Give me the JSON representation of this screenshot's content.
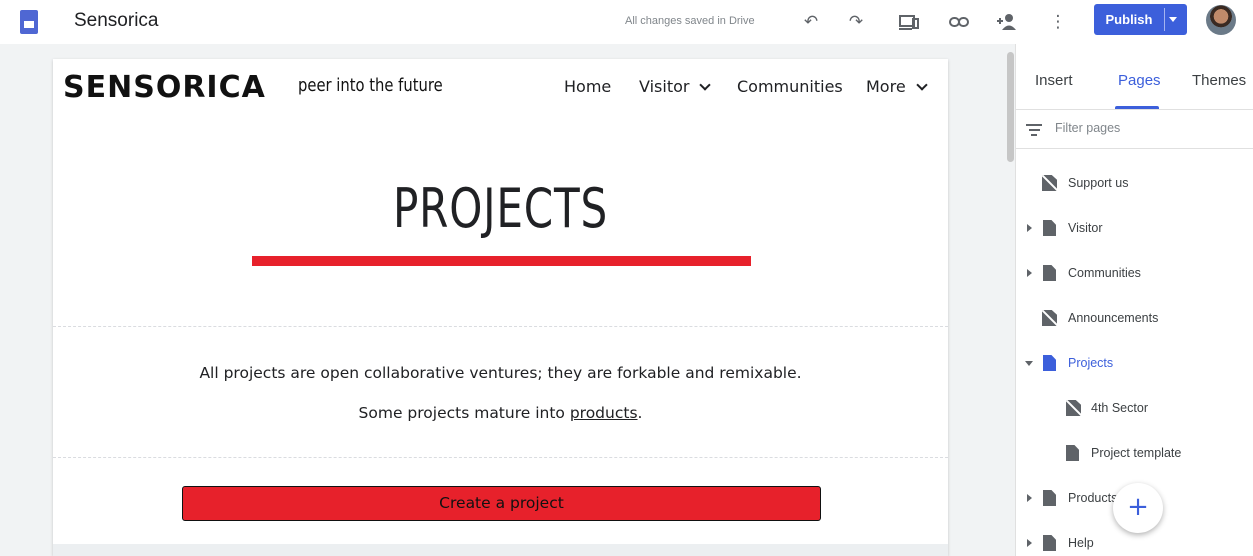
{
  "app": {
    "site_name": "Sensorica",
    "save_status": "All changes saved in Drive",
    "publish_label": "Publish",
    "icons": [
      "docs-icon",
      "undo-icon",
      "redo-icon",
      "preview-icon",
      "link-icon",
      "share-icon",
      "more-icon",
      "caret-down-icon",
      "avatar"
    ]
  },
  "site": {
    "logo_text": "SENSORICA",
    "tagline": "peer into the future",
    "nav": [
      {
        "label": "Home"
      },
      {
        "label": "Visitor"
      },
      {
        "label": "Communities"
      },
      {
        "label": "More"
      }
    ],
    "page_heading": "PROJECTS",
    "paragraph_1": "All projects are open collaborative ventures; they are forkable and remixable.",
    "paragraph_2_prefix": "Some projects mature into ",
    "paragraph_2_link": "products",
    "paragraph_2_suffix": ".",
    "cta_label": "Create a project",
    "accent_color": "#e7212b"
  },
  "panel": {
    "tabs": [
      {
        "label": "Insert",
        "active": false
      },
      {
        "label": "Pages",
        "active": true
      },
      {
        "label": "Themes",
        "active": false
      }
    ],
    "filter_placeholder": "Filter pages",
    "pages": [
      {
        "label": "Support us",
        "icon": "hidden-page-icon",
        "expand": "none",
        "level": 0
      },
      {
        "label": "Visitor",
        "icon": "page-icon",
        "expand": "right",
        "level": 0
      },
      {
        "label": "Communities",
        "icon": "page-icon",
        "expand": "right",
        "level": 0
      },
      {
        "label": "Announcements",
        "icon": "hidden-page-icon",
        "expand": "none",
        "level": 0
      },
      {
        "label": "Projects",
        "icon": "page-icon",
        "expand": "down",
        "level": 0,
        "active": true
      },
      {
        "label": "4th Sector",
        "icon": "hidden-page-icon",
        "expand": "none",
        "level": 1
      },
      {
        "label": "Project template",
        "icon": "page-icon",
        "expand": "none",
        "level": 1
      },
      {
        "label": "Products",
        "icon": "page-icon",
        "expand": "right",
        "level": 0
      },
      {
        "label": "Help",
        "icon": "page-icon",
        "expand": "right",
        "level": 0
      }
    ],
    "add_button_label": "+"
  }
}
